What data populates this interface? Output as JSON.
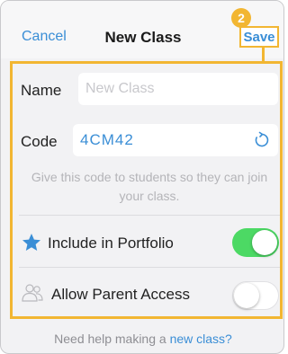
{
  "header": {
    "cancel_label": "Cancel",
    "title": "New Class",
    "save_label": "Save",
    "step_badge": "2"
  },
  "form": {
    "name_label": "Name",
    "name_placeholder": "New Class",
    "code_label": "Code",
    "code_value": "4CM42",
    "code_hint": "Give this code to students so they can join your class.",
    "portfolio_label": "Include in Portfolio",
    "portfolio_enabled": true,
    "parent_access_label": "Allow Parent Access",
    "parent_access_enabled": false
  },
  "footer": {
    "text": "Need help making a",
    "link_label": "new class?"
  },
  "colors": {
    "accent": "#3a8ed6",
    "highlight": "#f2b632",
    "toggle_on": "#4cd964"
  },
  "icons": {
    "code_refresh": "refresh-icon",
    "portfolio": "star-icon",
    "parent_access": "parents-icon"
  }
}
